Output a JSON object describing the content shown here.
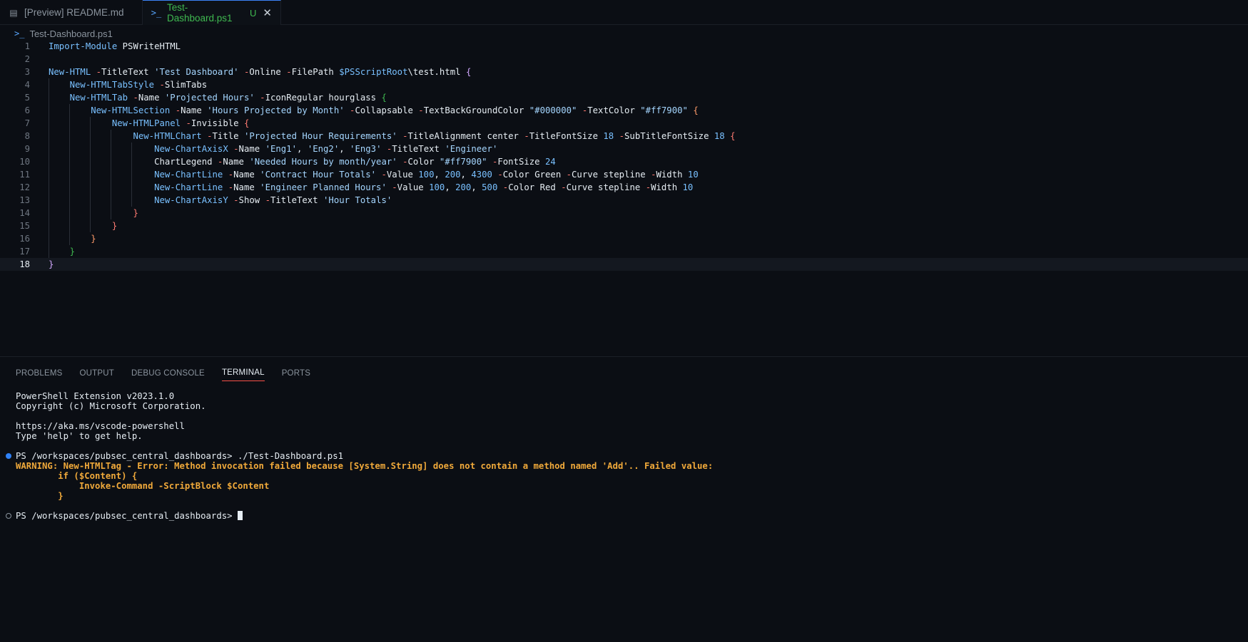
{
  "tabs": [
    {
      "label": "[Preview] README.md"
    },
    {
      "label": "Test-Dashboard.ps1",
      "modified": "U"
    }
  ],
  "breadcrumb": "Test-Dashboard.ps1",
  "editor": {
    "current_line": 18
  },
  "panel": {
    "tabs": [
      "PROBLEMS",
      "OUTPUT",
      "DEBUG CONSOLE",
      "TERMINAL",
      "PORTS"
    ],
    "active_tab": "TERMINAL"
  },
  "terminal": {
    "l1": "PowerShell Extension v2023.1.0",
    "l2": "Copyright (c) Microsoft Corporation.",
    "l3": "https://aka.ms/vscode-powershell",
    "l4": "Type 'help' to get help.",
    "prompt1": "PS /workspaces/pubsec_central_dashboards> ",
    "cmd1": "./Test-Dashboard.ps1",
    "warn1": "WARNING: New-HTMLTag - Error: Method invocation failed because [System.String] does not contain a method named 'Add'.. Failed value:",
    "warn2": "        if ($Content) {",
    "warn3": "            Invoke-Command -ScriptBlock $Content",
    "warn4": "        }",
    "prompt2": "PS /workspaces/pubsec_central_dashboards> "
  },
  "colors": {
    "accent_tab": "#3fb950",
    "terminal_active_underline": "#f85149",
    "warning": "#f0a93a"
  }
}
